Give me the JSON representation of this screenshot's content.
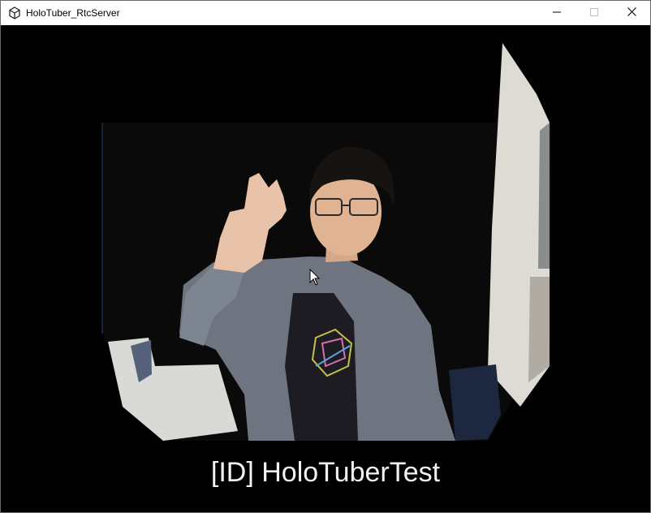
{
  "window": {
    "title": "HoloTuber_RtcServer",
    "app_icon": "unity-icon",
    "controls": {
      "minimize_icon": "minimize-icon",
      "maximize_icon": "maximize-icon",
      "close_icon": "close-icon"
    }
  },
  "stream": {
    "caption": "[ID] HoloTuberTest"
  },
  "colors": {
    "background": "#000000",
    "titlebar": "#ffffff",
    "caption_text": "#f2f2f2"
  }
}
